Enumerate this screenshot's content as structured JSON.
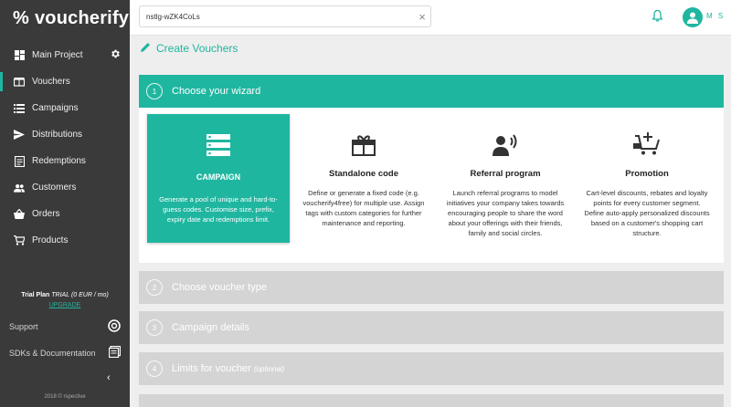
{
  "sidebar": {
    "logo": "voucherify",
    "items": [
      {
        "label": "Main Project",
        "icon": "dashboard-icon"
      },
      {
        "label": "Vouchers",
        "icon": "ticket-icon"
      },
      {
        "label": "Campaigns",
        "icon": "list-icon"
      },
      {
        "label": "Distributions",
        "icon": "send-icon"
      },
      {
        "label": "Redemptions",
        "icon": "document-icon"
      },
      {
        "label": "Customers",
        "icon": "people-icon"
      },
      {
        "label": "Orders",
        "icon": "basket-icon"
      },
      {
        "label": "Products",
        "icon": "cart-icon"
      }
    ],
    "plan_name": "Trial Plan",
    "plan_detail": "TRIAL (0 EUR / mo)",
    "upgrade": "UPGRADE",
    "support": "Support",
    "docs": "SDKs & Documentation",
    "copyright": "2018 © rspective"
  },
  "topbar": {
    "search_value": "nstlg-wZK4CoLs",
    "user_initials": "M S"
  },
  "page": {
    "title": "Create Vouchers"
  },
  "steps": [
    {
      "num": "1",
      "label": "Choose your wizard",
      "optional": ""
    },
    {
      "num": "2",
      "label": "Choose voucher type",
      "optional": ""
    },
    {
      "num": "3",
      "label": "Campaign details",
      "optional": ""
    },
    {
      "num": "4",
      "label": "Limits for voucher",
      "optional": "(optional)"
    }
  ],
  "cards": [
    {
      "title": "CAMPAIGN",
      "desc": "Generate a pool of unique and hard-to-guess codes. Customise size, prefix, expiry date and redemptions limit.",
      "icon": "stack-icon"
    },
    {
      "title": "Standalone code",
      "desc": "Define or generate a fixed code (e.g. voucherify4free) for multiple use. Assign tags with custom categories for further maintenance and reporting.",
      "icon": "gift-box-icon"
    },
    {
      "title": "Referral program",
      "desc": "Launch referral programs to model initiatives your company takes towards encouraging people to share the word about your offerings with their friends, family and social circles.",
      "icon": "person-speaking-icon"
    },
    {
      "title": "Promotion",
      "desc": "Cart-level discounts, rebates and loyalty points for every customer segment. Define auto-apply personalized discounts based on a customer's shopping cart structure.",
      "icon": "promo-cart-icon"
    }
  ],
  "colors": {
    "accent": "#1fb6a0",
    "sidebar": "#3a3a3a",
    "inactive_step": "#d4d4d4"
  }
}
